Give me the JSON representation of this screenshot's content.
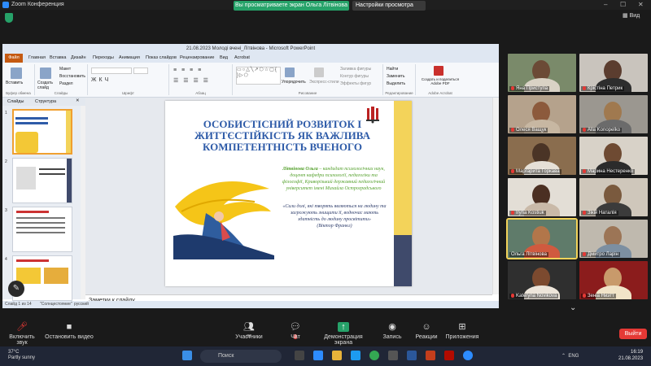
{
  "zoom": {
    "title": "Zoom Конференция",
    "share_status": "Вы просматриваете экран Ольга Літвінова",
    "view_options": "Настройки просмотра",
    "view_label": "Вид"
  },
  "ppt": {
    "window_title": "21.08.2023 Молоді вчені_Літвінова - Microsoft PowerPoint",
    "file_tab": "Файл",
    "tabs": [
      "Главная",
      "Вставка",
      "Дизайн",
      "Переходы",
      "Анимация",
      "Показ слайдов",
      "Рецензирование",
      "Вид",
      "Acrobat"
    ],
    "ribbon": {
      "paste": "Вставить",
      "create_slide": "Создать слайд",
      "layout": "Макет",
      "reset": "Восстановить",
      "section": "Раздел",
      "arrange": "Упорядочить",
      "quick_styles": "Экспресс-стили",
      "fill": "Заливка фигуры",
      "outline": "Контур фигуры",
      "effects": "Эффекты фигур",
      "find": "Найти",
      "replace": "Заменить",
      "select": "Выделить",
      "create_pdf": "Создать и поделиться Adobe PDF",
      "groups": [
        "Буфер обмена",
        "Слайды",
        "Шрифт",
        "Абзац",
        "Рисование",
        "Редактирование",
        "Adobe Acrobat"
      ]
    },
    "panel_tabs": [
      "Слайды",
      "Структура"
    ],
    "thumb_numbers": [
      "1",
      "2",
      "3",
      "4"
    ],
    "slide": {
      "title": "ОСОБИСТІСНИЙ РОЗВИТОК І ЖИТТЄСТІЙКІСТЬ ЯК ВАЖЛИВА КОМПЕТЕНТНІСТЬ ВЧЕНОГО",
      "author_name": "Літвінова Ольга",
      "author_info": " – кандидат психологічних наук, доцент кафедри психології, педагогіки та філософії, Криворізький державний педагогічний університет імені Михайла Остроградського",
      "quote": "«Сили долі, які творять являються на людину та загрожують знищити її, водночас мають здатність до людину просвітити»",
      "quote_author": "(Віктор Франкл)"
    },
    "notes": "Заметки к слайду",
    "status": {
      "slide": "Слайд 1 из 14",
      "theme": "\"Солнцестояние\"",
      "lang": "русский"
    }
  },
  "participants": [
    {
      "name": "Яна Приступа",
      "muted": true
    },
    {
      "name": "Крістіна Петрик",
      "muted": true
    },
    {
      "name": "Олеся Ващук",
      "muted": true
    },
    {
      "name": "Alla Konopelko",
      "muted": true
    },
    {
      "name": "Маргарита Горкава",
      "muted": true
    },
    {
      "name": "Марина Нестеренко",
      "muted": true
    },
    {
      "name": "Iryna Kostiuk",
      "muted": true
    },
    {
      "name": "Зікій Наталія",
      "muted": true
    },
    {
      "name": "Ольга Літвінова",
      "muted": false
    },
    {
      "name": "Дмитро Ларін",
      "muted": true
    },
    {
      "name": "Kateryna Novikova",
      "muted": true
    },
    {
      "name": "Зеніа Ниэтт",
      "muted": true
    }
  ],
  "toolbar": {
    "unmute": "Включить звук",
    "start_video": "Остановить видео",
    "participants": "Участники",
    "participants_count": "87",
    "chat": "Чат",
    "chat_badge": "2",
    "share": "Демонстрация экрана",
    "record": "Запись",
    "reactions": "Реакции",
    "apps": "Приложения",
    "end": "Выйти"
  },
  "taskbar": {
    "temp": "37°C",
    "weather": "Partly sunny",
    "search": "Поиск",
    "lang": "ENG",
    "time": "16:19",
    "date": "21.08.2023"
  }
}
